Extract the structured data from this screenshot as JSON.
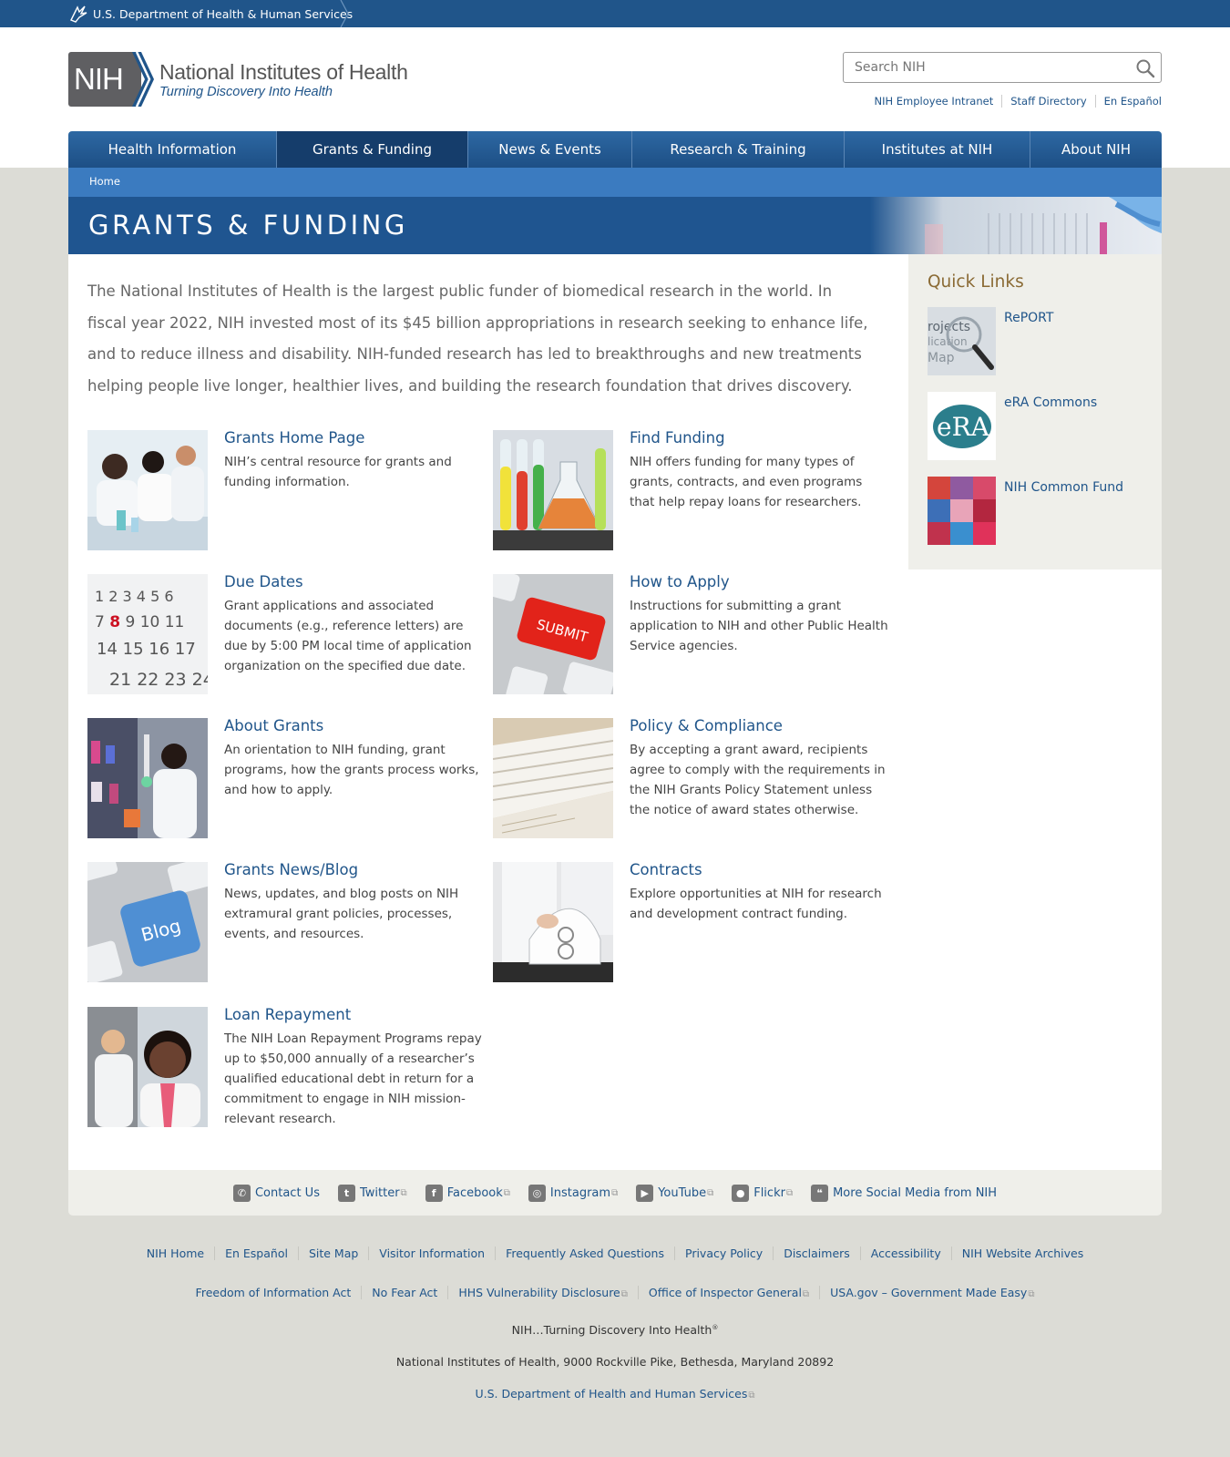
{
  "hhs": {
    "label": "U.S. Department of Health & Human Services"
  },
  "logo": {
    "abbr": "NIH",
    "title": "National Institutes of Health",
    "tagline": "Turning Discovery Into Health"
  },
  "search": {
    "placeholder": "Search NIH"
  },
  "util_links": [
    "NIH Employee Intranet",
    "Staff Directory",
    "En Español"
  ],
  "nav": [
    "Health Information",
    "Grants & Funding",
    "News & Events",
    "Research & Training",
    "Institutes at NIH",
    "About NIH"
  ],
  "breadcrumb": "Home",
  "page_title": "GRANTS & FUNDING",
  "intro": "The National Institutes of Health is the largest public funder of biomedical research in the world. In fiscal year 2022, NIH invested most of its $45 billion appropriations in research seeking to enhance life, and to reduce illness and disability. NIH-funded research has led to breakthroughs and new treatments helping people live longer, healthier lives, and building the research foundation that drives discovery.",
  "cards": [
    {
      "title": "Grants Home Page",
      "desc": "NIH’s central resource for grants and funding information."
    },
    {
      "title": "Find Funding",
      "desc": "NIH offers funding for many types of grants, contracts, and even programs that help repay loans for researchers."
    },
    {
      "title": "Due Dates",
      "desc": "Grant applications and associated documents (e.g., reference letters) are due by 5:00 PM local time of application organization on the specified due date."
    },
    {
      "title": "How to Apply",
      "desc": "Instructions for submitting a grant application to NIH and other Public Health Service agencies."
    },
    {
      "title": "About Grants",
      "desc": "An orientation to NIH funding, grant programs, how the grants process works, and how to apply."
    },
    {
      "title": "Policy & Compliance",
      "desc": "By accepting a grant award, recipients agree to comply with the requirements in the NIH Grants Policy Statement unless the notice of award states otherwise."
    },
    {
      "title": "Grants News/Blog",
      "desc": "News, updates, and blog posts on NIH extramural grant policies, processes, events, and resources."
    },
    {
      "title": "Contracts",
      "desc": "Explore opportunities at NIH for research and development contract funding."
    },
    {
      "title": "Loan Repayment",
      "desc": "The NIH Loan Repayment Programs repay up to $50,000 annually of a researcher’s qualified educational debt in return for a commitment to engage in NIH mission-relevant research."
    }
  ],
  "image_text": {
    "calendar": "1 2 3 4 5 6",
    "submit": "SUBMIT",
    "blog": "Blog",
    "era": "eRA",
    "report": "rojects"
  },
  "quick_links": {
    "title": "Quick Links",
    "items": [
      "RePORT",
      "eRA Commons",
      "NIH Common Fund"
    ]
  },
  "social": [
    {
      "icon": "phone-icon",
      "label": "Contact Us"
    },
    {
      "icon": "twitter-icon",
      "label": "Twitter"
    },
    {
      "icon": "facebook-icon",
      "label": "Facebook"
    },
    {
      "icon": "instagram-icon",
      "label": "Instagram"
    },
    {
      "icon": "youtube-icon",
      "label": "YouTube"
    },
    {
      "icon": "flickr-icon",
      "label": "Flickr"
    },
    {
      "icon": "chat-icon",
      "label": "More Social Media from NIH"
    }
  ],
  "footer_links_1": [
    "NIH Home",
    "En Español",
    "Site Map",
    "Visitor Information",
    "Frequently Asked Questions",
    "Privacy Policy",
    "Disclaimers",
    "Accessibility",
    "NIH Website Archives"
  ],
  "footer_links_2": [
    "Freedom of Information Act",
    "No Fear Act",
    "HHS Vulnerability Disclosure",
    "Office of Inspector General",
    "USA.gov – Government Made Easy"
  ],
  "footer_tagline": "NIH…Turning Discovery Into Health",
  "footer_registered": "®",
  "footer_address": "National Institutes of Health, 9000 Rockville Pike, Bethesda, Maryland 20892",
  "footer_hhs": "U.S. Department of Health and Human Services",
  "colors": {
    "primary": "#20558a",
    "nav_active": "#153d6b",
    "breadcrumb": "#3b7bc0",
    "quick_links_title": "#8a6a34"
  }
}
